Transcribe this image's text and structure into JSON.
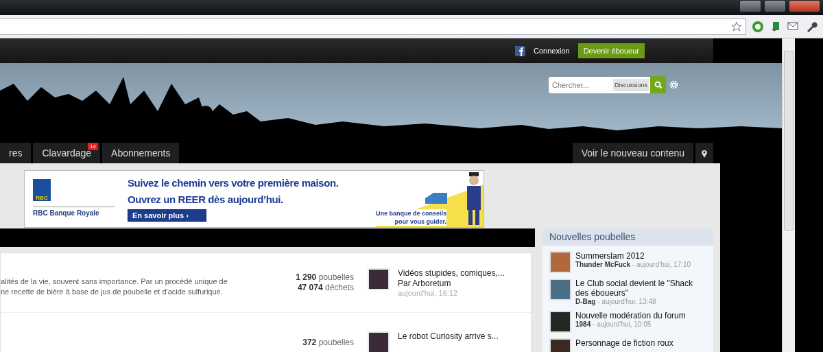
{
  "topbar": {
    "login": "Connexion",
    "signup": "Devenir éboueur"
  },
  "search": {
    "placeholder": "Chercher...",
    "scope": "Discussions"
  },
  "nav": {
    "tabs": [
      {
        "label": "res"
      },
      {
        "label": "Clavardage",
        "badge": "14"
      },
      {
        "label": "Abonnements"
      }
    ],
    "new_content": "Voir le nouveau contenu"
  },
  "ad": {
    "logo": "RBC",
    "brand": "RBC Banque Royale",
    "headline": [
      "Suivez le chemin vers votre première maison.",
      "Ouvrez un REER dès aujourd’hui."
    ],
    "button": "En savoir plus ›",
    "slogan": [
      "Une banque de conseils",
      "pour vous guider."
    ]
  },
  "forums": [
    {
      "description": [
        "alités de la vie, souvent sans importance. Par un procédé unique de",
        "ne recette de bière à base de jus de poubelle et d'acide sulfurique."
      ],
      "topics": "1 290",
      "topics_label": "poubelles",
      "posts": "47 074",
      "posts_label": "déchets",
      "last_title": "Vidéos stupides, comiques,...",
      "by": "Par",
      "author": "Arboretum",
      "time": "aujourd'hui, 16:12"
    },
    {
      "topics": "372",
      "topics_label": "poubelles",
      "last_title": "Le robot Curiosity arrive s..."
    }
  ],
  "sidebar": {
    "title": "Nouvelles poubelles",
    "items": [
      {
        "title": "Summerslam 2012",
        "meta": "**Thunder McFuck** - aujourd'hui, 17:10"
      },
      {
        "title": "Le Club social devient le \"Shack des éboueurs\"",
        "meta": "**D-Bag** - aujourd'hui, 13:48"
      },
      {
        "title": "Nouvelle modération du forum",
        "meta": "**1984** - aujourd'hui, 10:05"
      },
      {
        "title": "Personnage de fiction roux"
      }
    ]
  }
}
